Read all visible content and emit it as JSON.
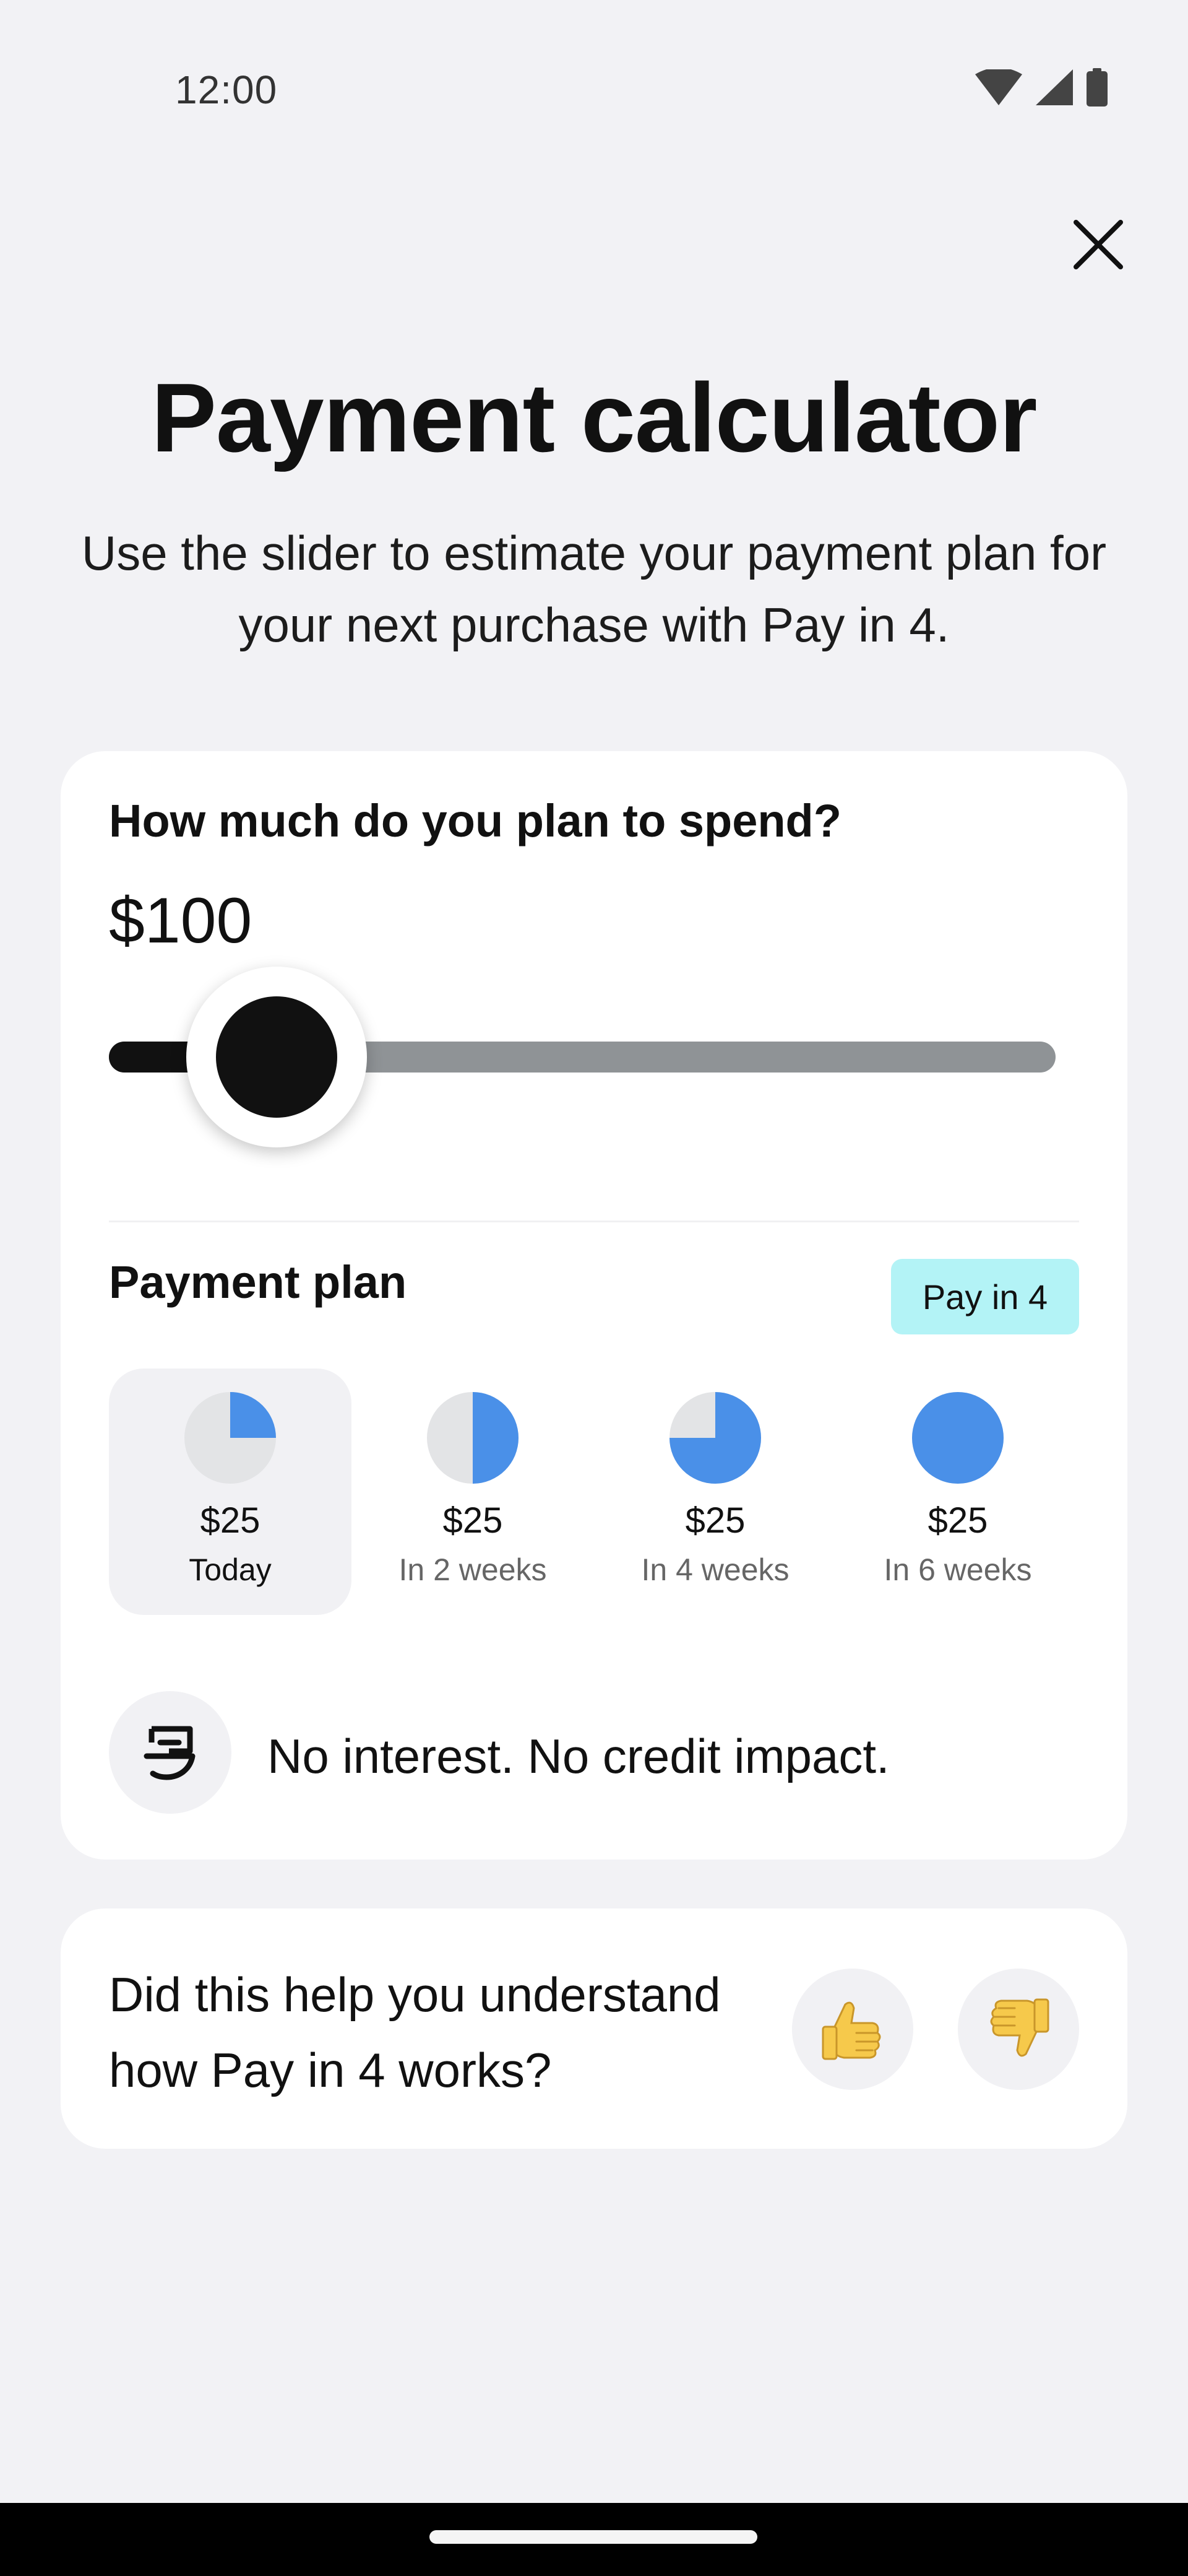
{
  "status_bar": {
    "time": "12:00"
  },
  "title": "Payment calculator",
  "subtitle": "Use the slider to estimate your payment plan for your next purchase with Pay in 4.",
  "spend": {
    "question": "How much do you plan to spend?",
    "amount": "$100",
    "slider_level": 0.177
  },
  "plan": {
    "label": "Payment plan",
    "badge": "Pay in 4",
    "installments": [
      {
        "amount": "$25",
        "when": "Today",
        "fraction": 0.25,
        "selected": true
      },
      {
        "amount": "$25",
        "when": "In 2 weeks",
        "fraction": 0.5,
        "selected": false
      },
      {
        "amount": "$25",
        "when": "In 4 weeks",
        "fraction": 0.75,
        "selected": false
      },
      {
        "amount": "$25",
        "when": "In 6 weeks",
        "fraction": 1.0,
        "selected": false
      }
    ]
  },
  "notice": {
    "text": "No interest. No credit impact.",
    "icon": "paypal-logo-icon"
  },
  "feedback": {
    "question": "Did this help you understand how Pay in 4 works?",
    "up_icon": "thumbs-up-icon",
    "down_icon": "thumbs-down-icon"
  },
  "colors": {
    "accent": "#4a90e8",
    "badge": "#b3f3f6",
    "pie_bg": "#e3e4e6"
  }
}
